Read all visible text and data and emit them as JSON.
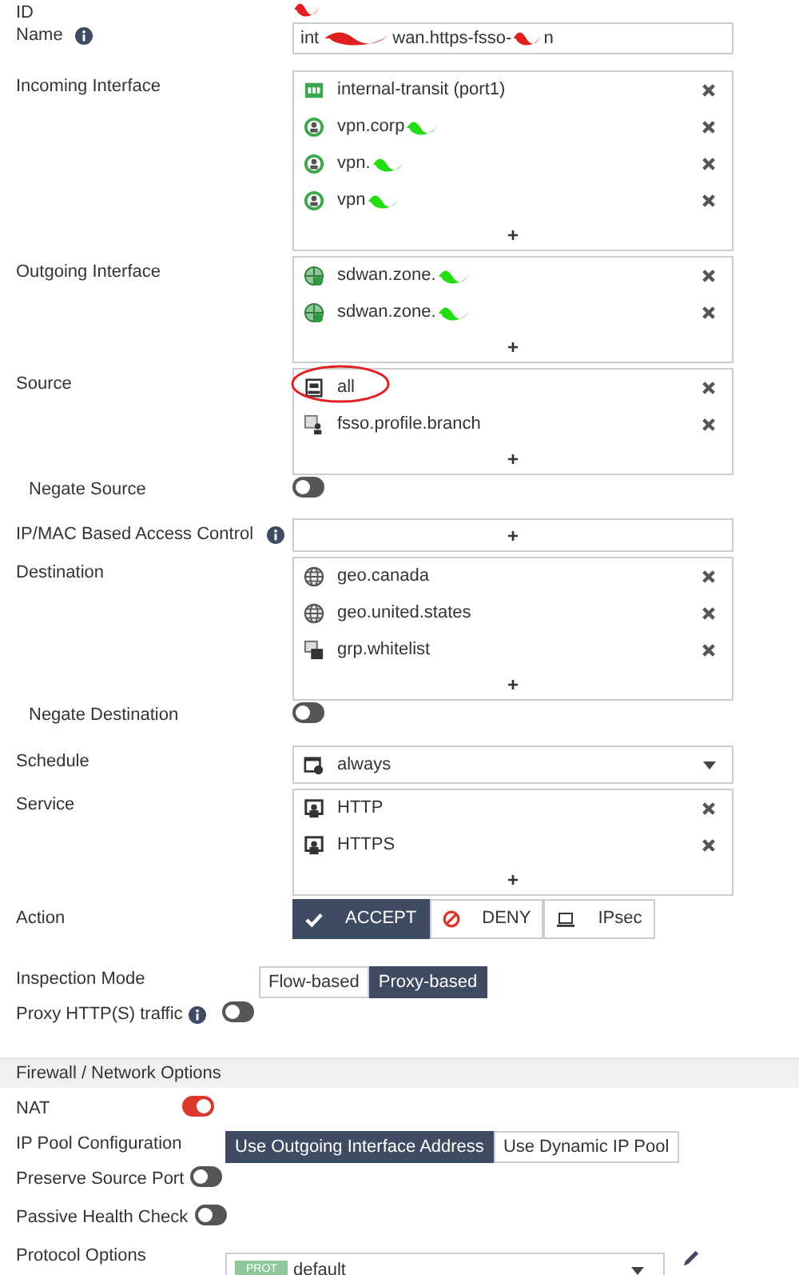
{
  "id_field": {
    "label": "ID",
    "redacted": true
  },
  "name_field": {
    "label": "Name",
    "info": true,
    "parts": [
      "int",
      "wan.https-fsso-",
      "n"
    ]
  },
  "lists": [
    {
      "label": "Incoming Interface",
      "items": [
        {
          "kind": "port",
          "text": "internal-transit (port1)",
          "redacted": false,
          "circled": false
        },
        {
          "kind": "vpn",
          "text": "vpn.corp",
          "redacted": true,
          "circled": false
        },
        {
          "kind": "vpn",
          "text": "vpn.",
          "redacted": true,
          "circled": false
        },
        {
          "kind": "vpn",
          "text": "vpn",
          "redacted": true,
          "circled": false
        }
      ],
      "add": "+"
    },
    {
      "label": "Outgoing Interface",
      "items": [
        {
          "kind": "zone",
          "text": "sdwan.zone.",
          "redacted": true,
          "circled": false
        },
        {
          "kind": "zone",
          "text": "sdwan.zone.",
          "redacted": true,
          "circled": false
        }
      ],
      "add": "+"
    },
    {
      "label": "Source",
      "items": [
        {
          "kind": "address",
          "text": "all",
          "redacted": false,
          "circled": true
        },
        {
          "kind": "user",
          "text": "fsso.profile.branch",
          "redacted": false,
          "circled": false
        }
      ],
      "add": "+",
      "negate": {
        "label": "Negate Source",
        "on": false
      }
    },
    {
      "label": "IP/MAC Based Access Control",
      "info": true,
      "add": "+"
    },
    {
      "label": "Destination",
      "items": [
        {
          "kind": "geo",
          "text": "geo.canada",
          "redacted": false,
          "circled": false
        },
        {
          "kind": "geo",
          "text": "geo.united.states",
          "redacted": false,
          "circled": false
        },
        {
          "kind": "group",
          "text": "grp.whitelist",
          "redacted": false,
          "circled": false
        }
      ],
      "add": "+",
      "negate": {
        "label": "Negate Destination",
        "on": false
      }
    }
  ],
  "schedule": {
    "label": "Schedule",
    "value": "always"
  },
  "service": {
    "label": "Service",
    "items": [
      {
        "kind": "service",
        "text": "HTTP",
        "redacted": false,
        "circled": false
      },
      {
        "kind": "service",
        "text": "HTTPS",
        "redacted": false,
        "circled": false
      }
    ],
    "add": "+"
  },
  "action": {
    "label": "Action",
    "options": [
      {
        "kind": "accept",
        "text": "ACCEPT",
        "selected": true
      },
      {
        "kind": "deny",
        "text": "DENY",
        "selected": false
      },
      {
        "kind": "ipsec",
        "text": "IPsec",
        "selected": false
      }
    ]
  },
  "inspection_mode": {
    "label": "Inspection Mode",
    "options": [
      {
        "text": "Flow-based",
        "selected": false
      },
      {
        "text": "Proxy-based",
        "selected": true
      }
    ]
  },
  "proxy_traffic": {
    "label": "Proxy HTTP(S) traffic",
    "info": true,
    "on": false
  },
  "section": {
    "title": "Firewall / Network Options"
  },
  "nat": {
    "label": "NAT",
    "on": true
  },
  "ip_pool": {
    "label": "IP Pool Configuration",
    "options": [
      {
        "text": "Use Outgoing Interface Address",
        "selected": true
      },
      {
        "text": "Use Dynamic IP Pool",
        "selected": false
      }
    ]
  },
  "preserve_source_port": {
    "label": "Preserve Source Port",
    "on": false
  },
  "passive_health_check": {
    "label": "Passive Health Check",
    "on": false
  },
  "protocol_options": {
    "label": "Protocol Options",
    "badge": "PROT",
    "value": "default"
  }
}
